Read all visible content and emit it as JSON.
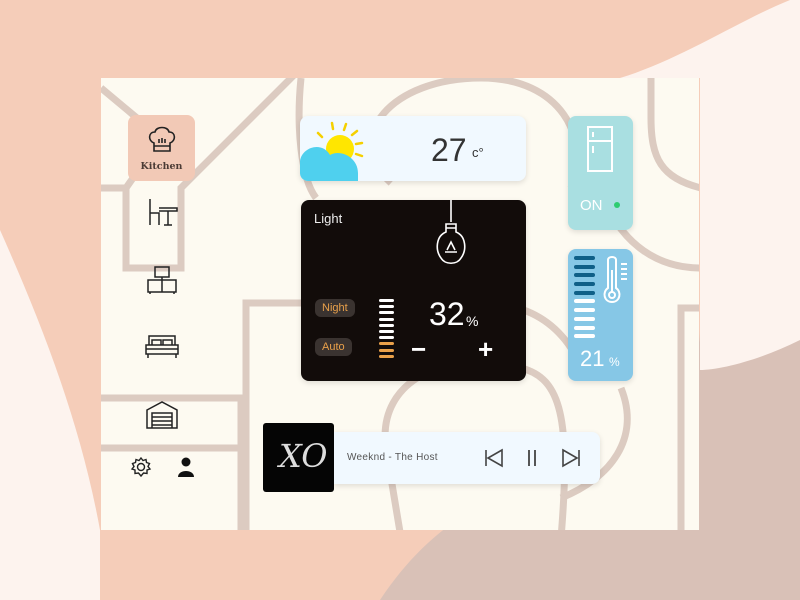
{
  "colors": {
    "accent": "#f2c9b6",
    "weather_bg": "#f1f9ff",
    "light_bg": "#120c0a",
    "fridge_bg": "#a9dfe1",
    "thermo_bg": "#86c7e6",
    "orange": "#eaa14a",
    "on_dot": "#2ecc71"
  },
  "sidebar": {
    "items": [
      {
        "label": "Kitchen",
        "icon": "chef-hat-icon",
        "active": true
      },
      {
        "icon": "dining-table-icon"
      },
      {
        "icon": "tv-icon"
      },
      {
        "icon": "bed-icon"
      },
      {
        "icon": "garage-icon"
      }
    ],
    "settings_icon": "gear-icon",
    "user_icon": "user-icon"
  },
  "weather": {
    "temp": "27",
    "unit": "c°",
    "icon": "sun-cloud-icon"
  },
  "light": {
    "title": "Light",
    "value": "32",
    "unit": "%",
    "level_bars_on": 3,
    "level_bars_total": 10,
    "modes": [
      "Night",
      "Auto"
    ],
    "minus": "−",
    "plus": "+",
    "icon": "light-bulb-icon"
  },
  "fridge": {
    "status": "ON",
    "icon": "fridge-icon"
  },
  "thermostat": {
    "value": "21",
    "unit": "%",
    "level_bars_on": 5,
    "level_bars_total": 10,
    "icon": "thermometer-icon"
  },
  "music": {
    "track": "Weeknd - The Host",
    "album_art_text": "XO"
  }
}
